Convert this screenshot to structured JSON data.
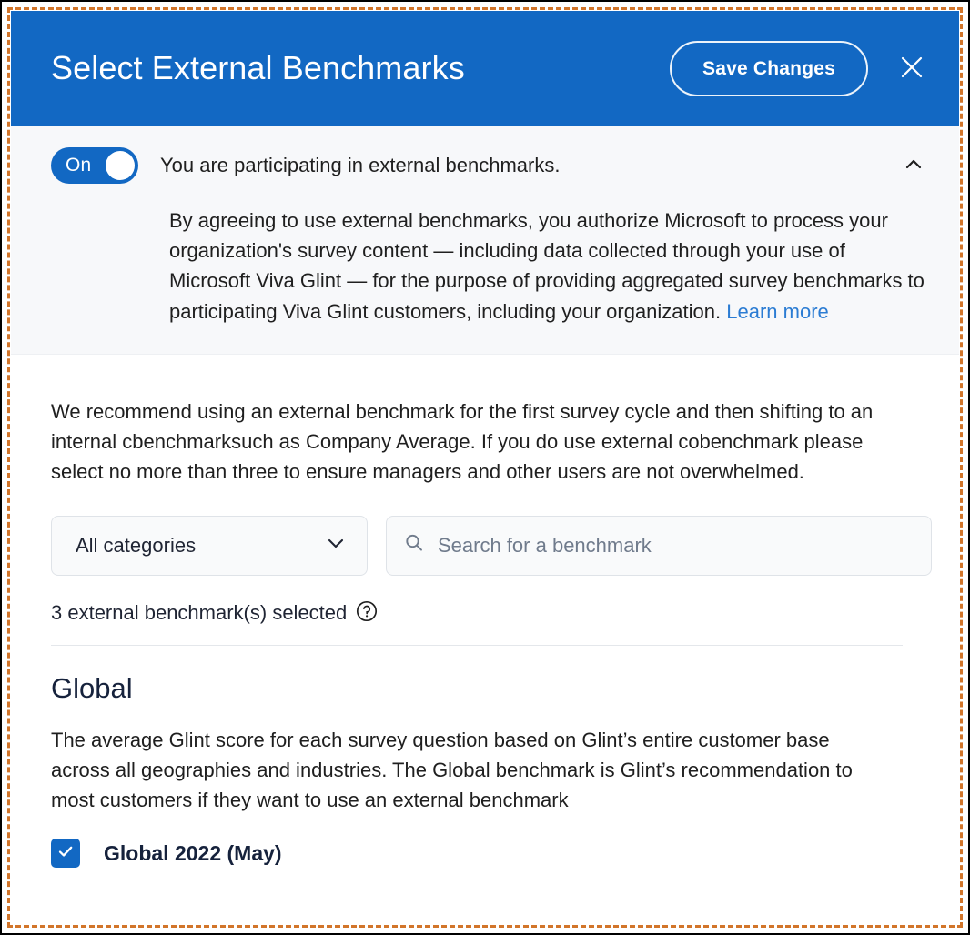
{
  "header": {
    "title": "Select External Benchmarks",
    "save_label": "Save Changes",
    "close_icon": "close-icon",
    "background_color": "#1268c3"
  },
  "consent": {
    "toggle_state_label": "On",
    "toggle_on": true,
    "heading": "You are participating in external benchmarks.",
    "collapse_icon": "chevron-up-icon",
    "body": "By agreeing to use external benchmarks, you authorize Microsoft to process your organization's survey content — including data collected through your use of Microsoft Viva Glint — for the purpose of providing aggregated survey benchmarks to participating Viva Glint customers, including your organization. ",
    "learn_more_label": "Learn more",
    "link_color": "#2b7cd3"
  },
  "body": {
    "recommendation": "We recommend using an external benchmark for the first survey cycle and then shifting to an internal cbenchmarksuch as Company Average. If you do use external cobenchmark please select no more than three to ensure managers and other users are not overwhelmed."
  },
  "filters": {
    "category": {
      "selected": "All categories",
      "chevron_icon": "chevron-down-icon"
    },
    "search": {
      "placeholder": "Search for a benchmark",
      "value": "",
      "icon": "search-icon"
    }
  },
  "selection": {
    "count_text": "3 external benchmark(s) selected",
    "help_icon": "question-circle-icon"
  },
  "groups": [
    {
      "title": "Global",
      "description": "The average Glint score for each survey question based on Glint’s entire customer base across all geographies and industries. The Global benchmark is Glint’s recommendation to most customers if they want to use an external benchmark",
      "items": [
        {
          "label": "Global 2022 (May)",
          "checked": true,
          "check_icon": "check-icon"
        }
      ]
    }
  ]
}
